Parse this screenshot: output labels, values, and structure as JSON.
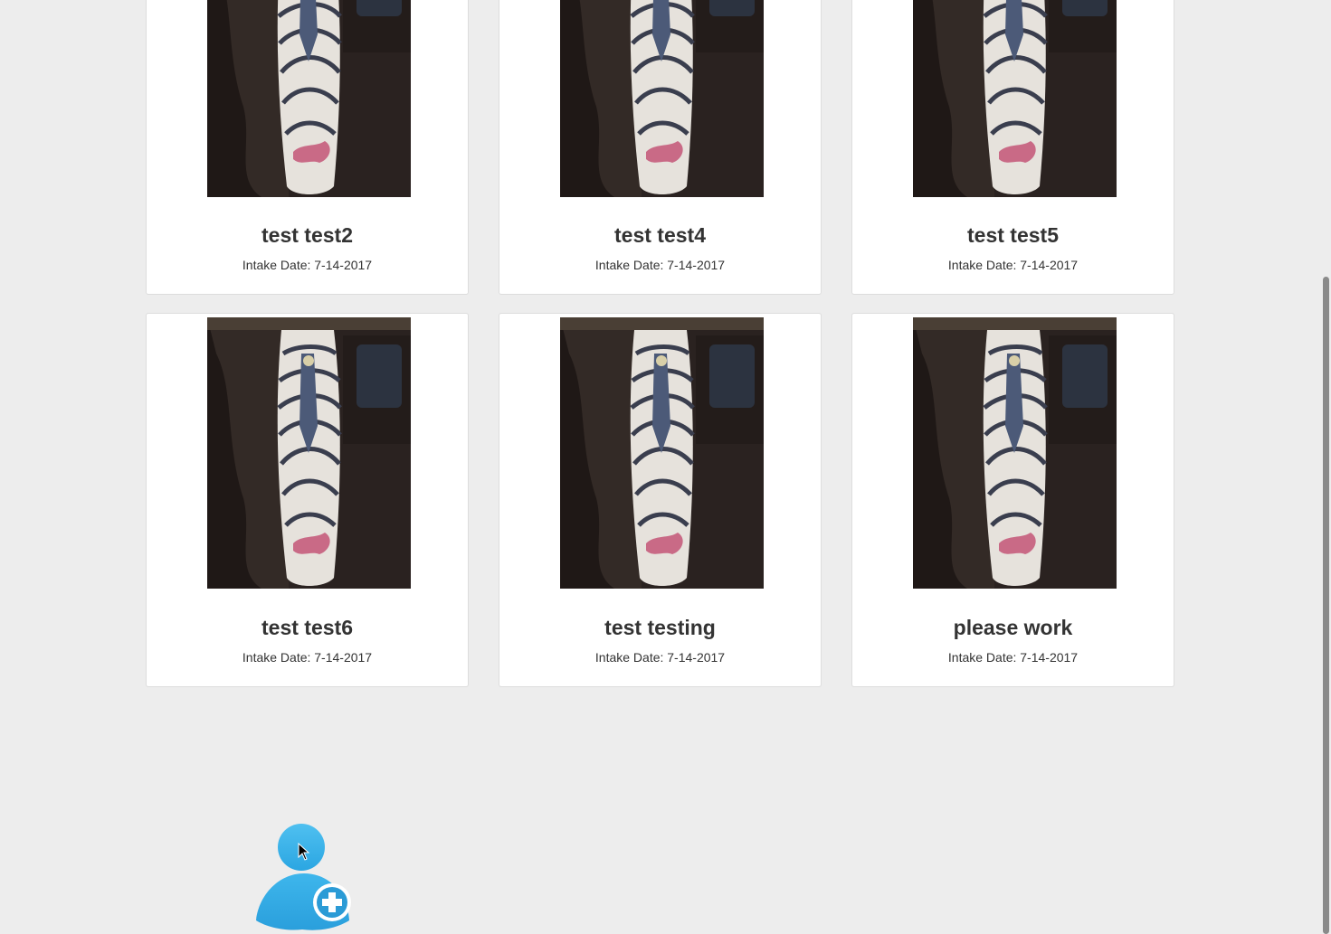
{
  "cards": [
    {
      "name": "test test2",
      "intake": "Intake Date: 7-14-2017"
    },
    {
      "name": "test test4",
      "intake": "Intake Date: 7-14-2017"
    },
    {
      "name": "test test5",
      "intake": "Intake Date: 7-14-2017"
    },
    {
      "name": "test test6",
      "intake": "Intake Date: 7-14-2017"
    },
    {
      "name": "test testing",
      "intake": "Intake Date: 7-14-2017"
    },
    {
      "name": "please work",
      "intake": "Intake Date: 7-14-2017"
    }
  ],
  "add_button": {
    "icon": "add-user-icon",
    "color": "#35aee8"
  },
  "colors": {
    "background": "#ededed",
    "card": "#ffffff",
    "accent": "#35aee8"
  }
}
